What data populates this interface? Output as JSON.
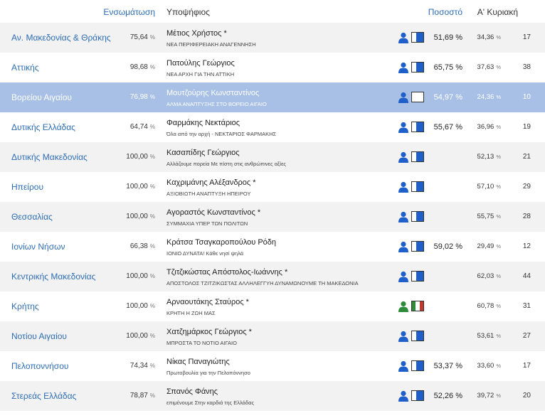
{
  "header": {
    "ensomatosi": "Ενσωμάτωση",
    "ypopsifios": "Υποψήφιος",
    "pososto": "Ποσοστό",
    "first_sunday": "Α' Κυριακή"
  },
  "colors": {
    "accent": "#2e6db4",
    "highlight_row": "#a8c0e6",
    "alt_row": "#f2f2f2",
    "avatar_blue": "#1f5fc9",
    "avatar_green": "#2e8b3a",
    "flag_red": "#c0392b"
  },
  "rows": [
    {
      "region": "Αν. Μακεδονίας & Θράκης",
      "ens": "75,64",
      "ens_unit": "%",
      "candidate": "Μέτιος Χρήστος *",
      "party": "ΝΕΑ ΠΕΡΙΦΕΡΕΙΑΚΗ ΑΝΑΓΕΝΝΗΣΗ",
      "avatar": "person-icon",
      "flag": "blue-flag-icon",
      "pct": "51,69 %",
      "first": "34,36",
      "first_unit": "%",
      "seats": "17"
    },
    {
      "region": "Αττικής",
      "ens": "98,68",
      "ens_unit": "%",
      "candidate": "Πατούλης Γεώργιος",
      "party": "ΝΕΑ ΑΡΧΗ ΓΙΑ ΤΗΝ ΑΤΤΙΚΗ",
      "avatar": "person-icon",
      "flag": "blue-flag-icon",
      "pct": "65,75 %",
      "first": "37,63",
      "first_unit": "%",
      "seats": "38"
    },
    {
      "region": "Βορείου Αιγαίου",
      "ens": "76,98",
      "ens_unit": "%",
      "candidate": "Μουτζούρης Κωνσταντίνος",
      "party": "ΑΛΜΑ ΑΝΑΠΤΥΞΗΣ ΣΤΟ ΒΟΡΕΙΟ ΑΙΓΑΙΟ",
      "avatar": "person-icon",
      "flag": "empty-flag-icon",
      "pct": "54,97 %",
      "first": "24,36",
      "first_unit": "%",
      "seats": "10"
    },
    {
      "region": "Δυτικής Ελλάδας",
      "ens": "64,74",
      "ens_unit": "%",
      "candidate": "Φαρμάκης Νεκτάριος",
      "party": "Όλα από την αρχή - ΝΕΚΤΑΡΙΟΣ ΦΑΡΜΑΚΗΣ",
      "avatar": "person-icon",
      "flag": "blue-flag-icon",
      "pct": "55,67 %",
      "first": "36,96",
      "first_unit": "%",
      "seats": "19"
    },
    {
      "region": "Δυτικής Μακεδονίας",
      "ens": "100,00",
      "ens_unit": "%",
      "candidate": "Κασαπίδης Γεώργιος",
      "party": "Αλλάζουμε πορεία Με πίστη στις ανθρώπινες αξίες",
      "avatar": "person-icon",
      "flag": "blue-flag-icon",
      "pct": "",
      "first": "52,13",
      "first_unit": "%",
      "seats": "21"
    },
    {
      "region": "Ηπείρου",
      "ens": "100,00",
      "ens_unit": "%",
      "candidate": "Καχριμάνης Αλέξανδρος *",
      "party": "ΑΞΙΟΒΙΩΤΗ ΑΝΑΠΤΥΞΗ ΗΠΕΙΡΟΥ",
      "avatar": "person-icon",
      "flag": "blue-flag-icon",
      "pct": "",
      "first": "57,10",
      "first_unit": "%",
      "seats": "29"
    },
    {
      "region": "Θεσσαλίας",
      "ens": "100,00",
      "ens_unit": "%",
      "candidate": "Αγοραστός Κωνσταντίνος *",
      "party": "ΣΥΜΜΑΧΙΑ ΥΠΕΡ ΤΩΝ ΠΟΛΙΤΩΝ",
      "avatar": "person-icon",
      "flag": "blue-flag-icon",
      "pct": "",
      "first": "55,75",
      "first_unit": "%",
      "seats": "28"
    },
    {
      "region": "Ιονίων Νήσων",
      "ens": "66,38",
      "ens_unit": "%",
      "candidate": "Κράτσα Τσαγκαροπούλου Ρόδη",
      "party": "ΙΟΝΙΟ ΔΥΝΑΤΑ! Κάθε νησί ψηλά",
      "avatar": "person-icon",
      "flag": "blue-flag-icon",
      "pct": "59,02 %",
      "first": "29,49",
      "first_unit": "%",
      "seats": "12"
    },
    {
      "region": "Κεντρικής Μακεδονίας",
      "ens": "100,00",
      "ens_unit": "%",
      "candidate": "Τζιτζικώστας Απόστολος-Ιωάννης *",
      "party": "ΑΠΟΣΤΟΛΟΣ ΤΖΙΤΖΙΚΩΣΤΑΣ ΑΛΛΗΛΕΓΓΥΗ ΔΥΝΑΜΩΝΟΥΜΕ ΤΗ ΜΑΚΕΔΟΝΙΑ",
      "avatar": "person-icon",
      "flag": "blue-flag-icon",
      "pct": "",
      "first": "62,03",
      "first_unit": "%",
      "seats": "44"
    },
    {
      "region": "Κρήτης",
      "ens": "100,00",
      "ens_unit": "%",
      "candidate": "Αρναουτάκης Σταύρος *",
      "party": "ΚΡΗΤΗ Η ΖΩΗ ΜΑΣ",
      "avatar": "person-green-icon",
      "flag": "green-red-flag-icon",
      "pct": "",
      "first": "60,78",
      "first_unit": "%",
      "seats": "31"
    },
    {
      "region": "Νοτίου Αιγαίου",
      "ens": "100,00",
      "ens_unit": "%",
      "candidate": "Χατζημάρκος Γεώργιος *",
      "party": "ΜΠΡΟΣΤΑ ΤΟ ΝΟΤΙΟ ΑΙΓΑΙΟ",
      "avatar": "person-icon",
      "flag": "blue-flag-icon",
      "pct": "",
      "first": "53,61",
      "first_unit": "%",
      "seats": "27"
    },
    {
      "region": "Πελοποννήσου",
      "ens": "74,34",
      "ens_unit": "%",
      "candidate": "Νίκας Παναγιώτης",
      "party": "Πρωτοβουλία για την Πελοπόννησο",
      "avatar": "person-icon",
      "flag": "blue-flag-icon",
      "pct": "53,37 %",
      "first": "33,60",
      "first_unit": "%",
      "seats": "17"
    },
    {
      "region": "Στερεάς Ελλάδας",
      "ens": "78,87",
      "ens_unit": "%",
      "candidate": "Σπανός Φάνης",
      "party": "επιμένουμε Στην καρδιά της Ελλάδας",
      "avatar": "person-icon",
      "flag": "blue-flag-icon",
      "pct": "52,26 %",
      "first": "39,72",
      "first_unit": "%",
      "seats": "20"
    }
  ]
}
